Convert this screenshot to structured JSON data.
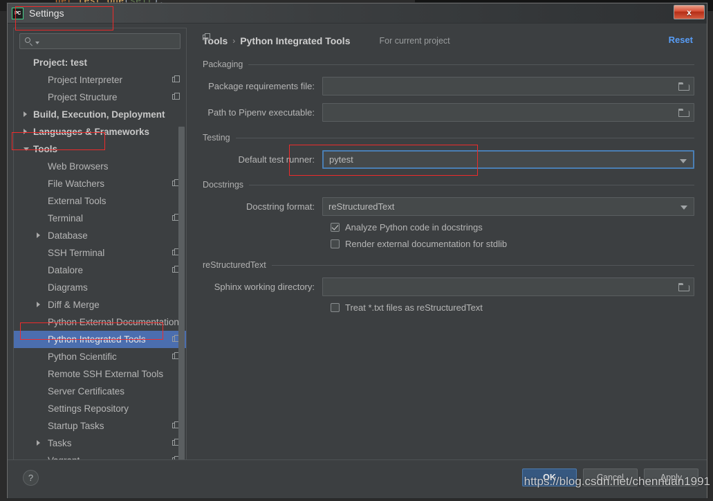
{
  "background_code": {
    "kw": "def",
    "fn": "test_one",
    "paren_open": "(",
    "param": "self",
    "paren_close": "):"
  },
  "window": {
    "title": "Settings",
    "app_icon": "pycharm-icon",
    "close_label": "x"
  },
  "search": {
    "placeholder": "",
    "value": "",
    "icon": "search-icon"
  },
  "sidebar": {
    "items": [
      {
        "label": "Project: test",
        "level": 0,
        "bold": true,
        "arrow": "none",
        "copy": false,
        "selected": false
      },
      {
        "label": "Project Interpreter",
        "level": 1,
        "bold": false,
        "arrow": "none",
        "copy": true,
        "selected": false
      },
      {
        "label": "Project Structure",
        "level": 1,
        "bold": false,
        "arrow": "none",
        "copy": true,
        "selected": false
      },
      {
        "label": "Build, Execution, Deployment",
        "level": 0,
        "bold": true,
        "arrow": "right",
        "copy": false,
        "selected": false
      },
      {
        "label": "Languages & Frameworks",
        "level": 0,
        "bold": true,
        "arrow": "right",
        "copy": false,
        "selected": false
      },
      {
        "label": "Tools",
        "level": 0,
        "bold": true,
        "arrow": "down",
        "copy": false,
        "selected": false
      },
      {
        "label": "Web Browsers",
        "level": 1,
        "bold": false,
        "arrow": "none",
        "copy": false,
        "selected": false
      },
      {
        "label": "File Watchers",
        "level": 1,
        "bold": false,
        "arrow": "none",
        "copy": true,
        "selected": false
      },
      {
        "label": "External Tools",
        "level": 1,
        "bold": false,
        "arrow": "none",
        "copy": false,
        "selected": false
      },
      {
        "label": "Terminal",
        "level": 1,
        "bold": false,
        "arrow": "none",
        "copy": true,
        "selected": false
      },
      {
        "label": "Database",
        "level": 1,
        "bold": false,
        "arrow": "right",
        "copy": false,
        "selected": false
      },
      {
        "label": "SSH Terminal",
        "level": 1,
        "bold": false,
        "arrow": "none",
        "copy": true,
        "selected": false
      },
      {
        "label": "Datalore",
        "level": 1,
        "bold": false,
        "arrow": "none",
        "copy": true,
        "selected": false
      },
      {
        "label": "Diagrams",
        "level": 1,
        "bold": false,
        "arrow": "none",
        "copy": false,
        "selected": false
      },
      {
        "label": "Diff & Merge",
        "level": 1,
        "bold": false,
        "arrow": "right",
        "copy": false,
        "selected": false
      },
      {
        "label": "Python External Documentation",
        "level": 1,
        "bold": false,
        "arrow": "none",
        "copy": false,
        "selected": false
      },
      {
        "label": "Python Integrated Tools",
        "level": 1,
        "bold": false,
        "arrow": "none",
        "copy": true,
        "selected": true
      },
      {
        "label": "Python Scientific",
        "level": 1,
        "bold": false,
        "arrow": "none",
        "copy": true,
        "selected": false
      },
      {
        "label": "Remote SSH External Tools",
        "level": 1,
        "bold": false,
        "arrow": "none",
        "copy": false,
        "selected": false
      },
      {
        "label": "Server Certificates",
        "level": 1,
        "bold": false,
        "arrow": "none",
        "copy": false,
        "selected": false
      },
      {
        "label": "Settings Repository",
        "level": 1,
        "bold": false,
        "arrow": "none",
        "copy": false,
        "selected": false
      },
      {
        "label": "Startup Tasks",
        "level": 1,
        "bold": false,
        "arrow": "none",
        "copy": true,
        "selected": false
      },
      {
        "label": "Tasks",
        "level": 1,
        "bold": false,
        "arrow": "right",
        "copy": true,
        "selected": false
      },
      {
        "label": "Vagrant",
        "level": 1,
        "bold": false,
        "arrow": "none",
        "copy": true,
        "selected": false
      }
    ]
  },
  "content": {
    "breadcrumb": {
      "parent": "Tools",
      "separator": "›",
      "current": "Python Integrated Tools"
    },
    "scope_note": "For current project",
    "reset_label": "Reset",
    "sections": {
      "packaging": {
        "title": "Packaging",
        "package_requirements_label": "Package requirements file:",
        "package_requirements_value": "",
        "pipenv_label": "Path to Pipenv executable:",
        "pipenv_value": ""
      },
      "testing": {
        "title": "Testing",
        "test_runner_label": "Default test runner:",
        "test_runner_value": "pytest"
      },
      "docstrings": {
        "title": "Docstrings",
        "docstring_format_label": "Docstring format:",
        "docstring_format_value": "reStructuredText",
        "analyze_label": "Analyze Python code in docstrings",
        "analyze_checked": true,
        "render_label": "Render external documentation for stdlib",
        "render_checked": false
      },
      "restructuredtext": {
        "title": "reStructuredText",
        "sphinx_label": "Sphinx working directory:",
        "sphinx_value": "",
        "treat_txt_label": "Treat *.txt files as reStructuredText",
        "treat_txt_checked": false
      }
    }
  },
  "footer": {
    "help_label": "?",
    "ok_label": "OK",
    "cancel_label": "Cancel",
    "apply_mnemonic": "A",
    "apply_rest": "pply"
  },
  "watermark": "https://blog.csdn.net/chennuan1991",
  "colors": {
    "accent_selection": "#4b6eaf",
    "link": "#589df6",
    "highlight_box": "#ef2b2b",
    "primary_button": "#365880",
    "panel_bg": "#3c3f41",
    "field_bg": "#45494a"
  }
}
